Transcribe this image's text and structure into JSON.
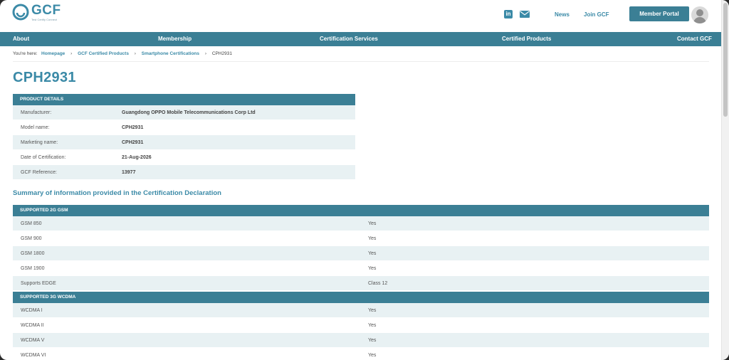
{
  "header": {
    "logo_title": "GCF",
    "logo_tagline": "Test Certify Connect",
    "linkedin_label": "in",
    "links": [
      "News",
      "Join GCF"
    ],
    "member_button": "Member Portal"
  },
  "nav": [
    "About",
    "Membership",
    "Certification Services",
    "Certified Products",
    "Contact GCF"
  ],
  "breadcrumb": {
    "prefix": "You're here:",
    "items": [
      "Homepage",
      "GCF Certified Products",
      "Smartphone Certifications"
    ],
    "current": "CPH2931"
  },
  "page_title": "CPH2931",
  "product_details": {
    "header": "PRODUCT DETAILS",
    "rows": [
      {
        "label": "Manufacturer:",
        "value": "Guangdong OPPO Mobile Telecommunications Corp Ltd"
      },
      {
        "label": "Model name:",
        "value": "CPH2931"
      },
      {
        "label": "Marketing name:",
        "value": "CPH2931"
      },
      {
        "label": "Date of Certification:",
        "value": "21-Aug-2026"
      },
      {
        "label": "GCF Reference:",
        "value": "13977"
      }
    ]
  },
  "summary_title": "Summary of information provided in the Certification Declaration",
  "gsm": {
    "header": "SUPPORTED 2G GSM",
    "rows": [
      {
        "label": "GSM 850",
        "value": "Yes"
      },
      {
        "label": "GSM 900",
        "value": "Yes"
      },
      {
        "label": "GSM 1800",
        "value": "Yes"
      },
      {
        "label": "GSM 1900",
        "value": "Yes"
      },
      {
        "label": "Supports EDGE",
        "value": "Class 12"
      }
    ]
  },
  "wcdma": {
    "header": "SUPPORTED 3G WCDMA",
    "rows": [
      {
        "label": "WCDMA I",
        "value": "Yes"
      },
      {
        "label": "WCDMA II",
        "value": "Yes"
      },
      {
        "label": "WCDMA V",
        "value": "Yes"
      },
      {
        "label": "WCDMA VI",
        "value": "Yes"
      }
    ]
  },
  "colors": {
    "brand": "#3b8aa7",
    "nav_bg": "#3b7f95",
    "row_alt": "#e8f1f3"
  }
}
